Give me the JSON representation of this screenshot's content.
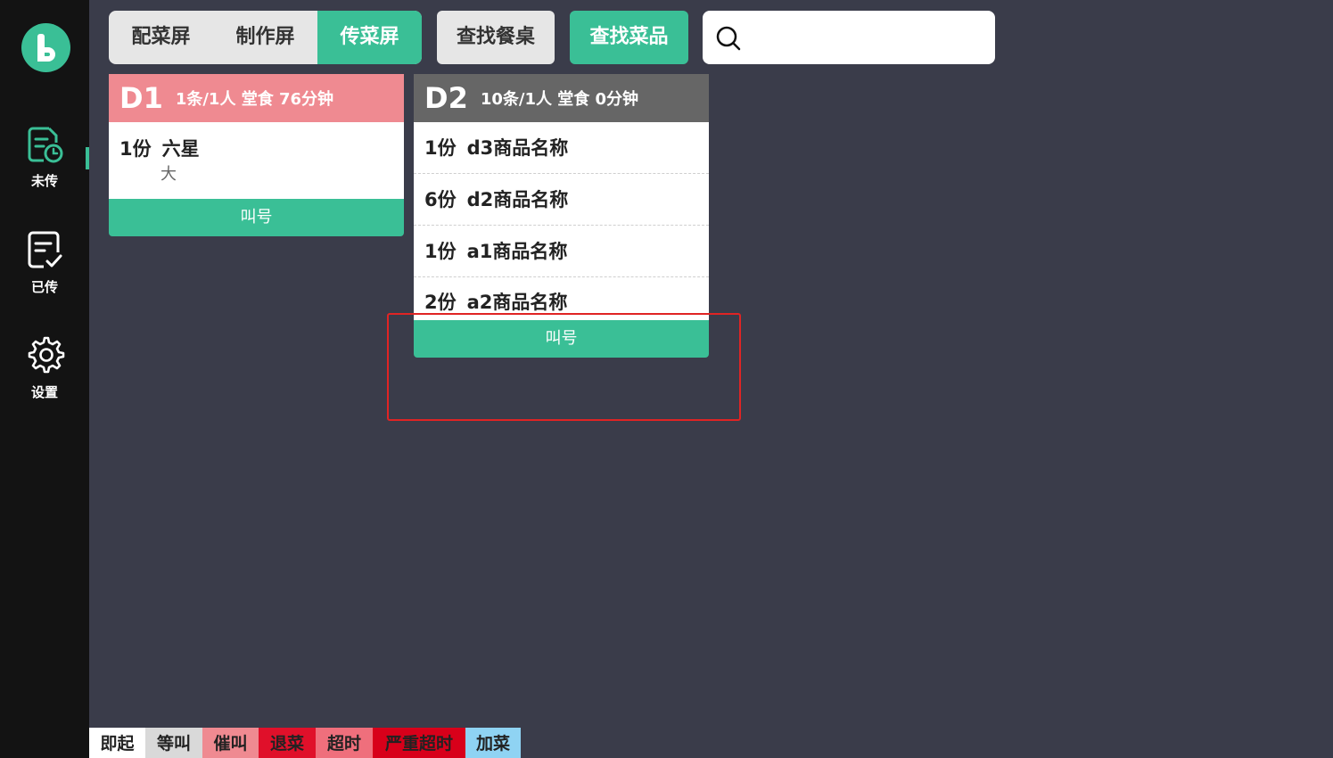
{
  "sidebar": {
    "items": [
      {
        "label": "未传",
        "icon": "pending-list-icon"
      },
      {
        "label": "已传",
        "icon": "done-list-icon"
      },
      {
        "label": "设置",
        "icon": "gear-icon"
      }
    ]
  },
  "tabs": [
    {
      "label": "配菜屏",
      "active": false
    },
    {
      "label": "制作屏",
      "active": false
    },
    {
      "label": "传菜屏",
      "active": true
    }
  ],
  "toolbar": {
    "find_table": "查找餐桌",
    "find_dish": "查找菜品",
    "search_value": ""
  },
  "cards": [
    {
      "code": "D1",
      "meta": "1条/1人  堂食  76分钟",
      "header_color": "#ef8a91",
      "items": [
        {
          "qty": "1份",
          "name": "六星",
          "spec": "大"
        }
      ],
      "call_label": "叫号"
    },
    {
      "code": "D2",
      "meta": "10条/1人  堂食  0分钟",
      "header_color": "#666666",
      "items": [
        {
          "qty": "1份",
          "name": "d3商品名称"
        },
        {
          "qty": "6份",
          "name": "d2商品名称"
        },
        {
          "qty": "1份",
          "name": "a1商品名称"
        },
        {
          "qty": "2份",
          "name": "a2商品名称"
        }
      ],
      "call_label": "叫号"
    }
  ],
  "legend": [
    {
      "label": "即起",
      "color": "#ffffff"
    },
    {
      "label": "等叫",
      "color": "#d9d9d9"
    },
    {
      "label": "催叫",
      "color": "#ef8a91"
    },
    {
      "label": "退菜",
      "color": "#e0102a"
    },
    {
      "label": "超时",
      "color": "#ef6f7c"
    },
    {
      "label": "严重超时",
      "color": "#d8001a"
    },
    {
      "label": "加菜",
      "color": "#8fd3f3"
    }
  ],
  "colors": {
    "accent": "#3abf96",
    "background": "#3a3c4a",
    "sidebar": "#131313"
  }
}
